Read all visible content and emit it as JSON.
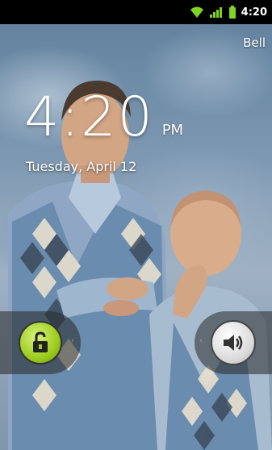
{
  "status_bar": {
    "time": "4:20",
    "wifi_icon": "wifi-icon",
    "signal_icon": "signal-icon",
    "battery_icon": "battery-icon",
    "accent_color": "#7fd321"
  },
  "lockscreen": {
    "carrier": "Bell",
    "time": "4:20",
    "ampm": "PM",
    "date": "Tuesday, April 12",
    "unlock_icon": "unlock-icon",
    "sound_icon": "sound-icon",
    "unlock_color": "#9ccc1d"
  }
}
